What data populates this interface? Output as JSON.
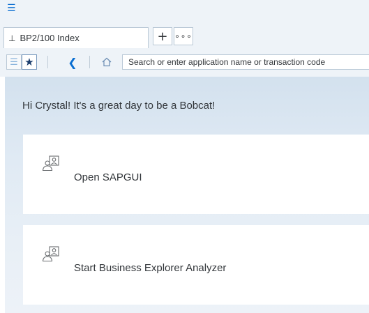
{
  "shell": {
    "menu_icon": "hamburger-menu-icon"
  },
  "tabs": [
    {
      "label": "BP2/100 Index",
      "icon": "sitemap-icon"
    }
  ],
  "tab_actions": {
    "add_label": "+",
    "more_label": "∘∘∘"
  },
  "toolbar": {
    "list_icon": "list-icon",
    "favorites_icon": "star-icon",
    "back_icon": "chevron-left-icon",
    "home_icon": "home-icon",
    "search_placeholder": "Search or enter application name or transaction code"
  },
  "main": {
    "greeting": "Hi Crystal! It's a great day to be a Bobcat!",
    "tiles": [
      {
        "label": "Open SAPGUI",
        "icon": "group-users-icon"
      },
      {
        "label": "Start Business Explorer Analyzer",
        "icon": "group-users-icon"
      }
    ]
  },
  "colors": {
    "accent": "#0a6ed1",
    "shell_bg": "#eef3f8",
    "tile_bg": "#ffffff"
  }
}
